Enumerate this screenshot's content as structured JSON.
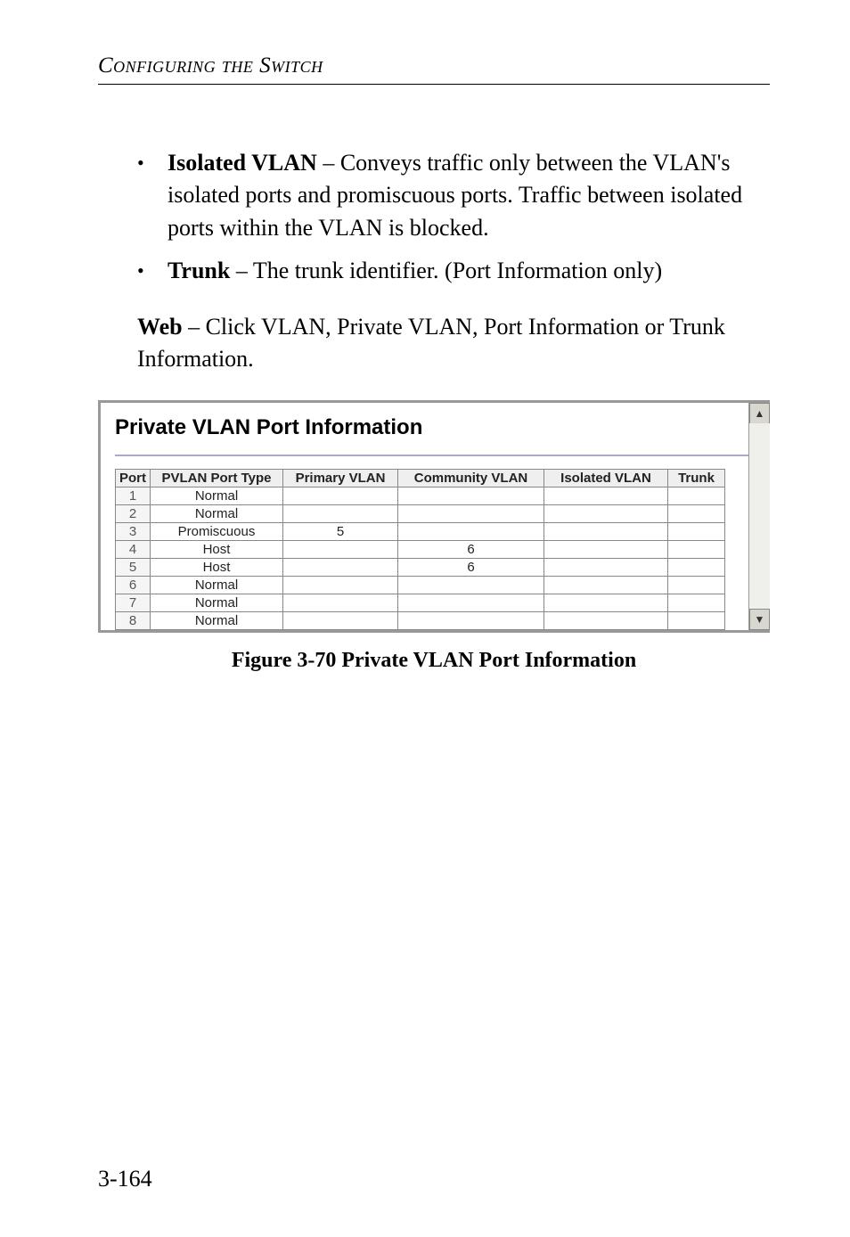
{
  "header": {
    "running_title": "Configuring the Switch"
  },
  "bullets": [
    {
      "term": "Isolated VLAN",
      "rest": " –  Conveys traffic only between the VLAN's isolated ports and promiscuous ports. Traffic between isolated ports within the VLAN is blocked."
    },
    {
      "term": "Trunk",
      "rest": " – The trunk identifier. (Port Information only)"
    }
  ],
  "web_paragraph": {
    "lead": "Web",
    "rest": " – Click VLAN, Private VLAN, Port Information or Trunk Information."
  },
  "screenshot": {
    "title": "Private VLAN Port Information",
    "columns": [
      "Port",
      "PVLAN Port Type",
      "Primary VLAN",
      "Community VLAN",
      "Isolated VLAN",
      "Trunk"
    ],
    "rows": [
      {
        "port": "1",
        "type": "Normal",
        "primary": "",
        "community": "",
        "isolated": "",
        "trunk": ""
      },
      {
        "port": "2",
        "type": "Normal",
        "primary": "",
        "community": "",
        "isolated": "",
        "trunk": ""
      },
      {
        "port": "3",
        "type": "Promiscuous",
        "primary": "5",
        "community": "",
        "isolated": "",
        "trunk": ""
      },
      {
        "port": "4",
        "type": "Host",
        "primary": "",
        "community": "6",
        "isolated": "",
        "trunk": ""
      },
      {
        "port": "5",
        "type": "Host",
        "primary": "",
        "community": "6",
        "isolated": "",
        "trunk": ""
      },
      {
        "port": "6",
        "type": "Normal",
        "primary": "",
        "community": "",
        "isolated": "",
        "trunk": ""
      },
      {
        "port": "7",
        "type": "Normal",
        "primary": "",
        "community": "",
        "isolated": "",
        "trunk": ""
      },
      {
        "port": "8",
        "type": "Normal",
        "primary": "",
        "community": "",
        "isolated": "",
        "trunk": ""
      }
    ],
    "scroll_up_glyph": "▲",
    "scroll_down_glyph": "▼"
  },
  "figure_caption": "Figure 3-70  Private VLAN Port Information",
  "page_number": "3-164",
  "chart_data": {
    "type": "table",
    "title": "Private VLAN Port Information",
    "columns": [
      "Port",
      "PVLAN Port Type",
      "Primary VLAN",
      "Community VLAN",
      "Isolated VLAN",
      "Trunk"
    ],
    "rows": [
      [
        1,
        "Normal",
        null,
        null,
        null,
        null
      ],
      [
        2,
        "Normal",
        null,
        null,
        null,
        null
      ],
      [
        3,
        "Promiscuous",
        5,
        null,
        null,
        null
      ],
      [
        4,
        "Host",
        null,
        6,
        null,
        null
      ],
      [
        5,
        "Host",
        null,
        6,
        null,
        null
      ],
      [
        6,
        "Normal",
        null,
        null,
        null,
        null
      ],
      [
        7,
        "Normal",
        null,
        null,
        null,
        null
      ],
      [
        8,
        "Normal",
        null,
        null,
        null,
        null
      ]
    ]
  }
}
